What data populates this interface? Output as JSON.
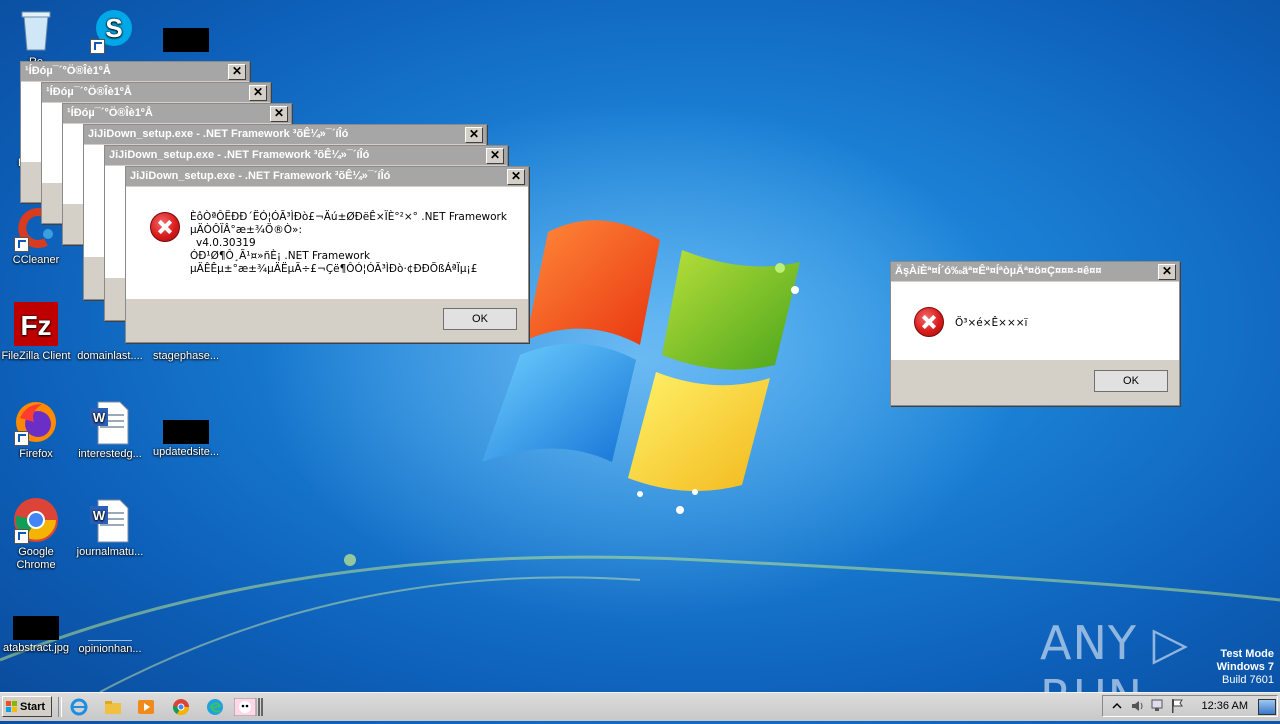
{
  "desktop": {
    "icons": [
      {
        "label": "Re"
      },
      {
        "label": ""
      },
      {
        "label": ""
      },
      {
        "label": "A Re"
      },
      {
        "label": "CCleaner"
      },
      {
        "label": "FileZilla Client"
      },
      {
        "label": "domainlast...."
      },
      {
        "label": "stagephase..."
      },
      {
        "label": "Firefox"
      },
      {
        "label": "interestedg..."
      },
      {
        "label": "updatedsite..."
      },
      {
        "label": "Google Chrome"
      },
      {
        "label": "journalmatu..."
      },
      {
        "label": "atabstract.jpg"
      },
      {
        "label": "opinionhan..."
      }
    ]
  },
  "dialogs": {
    "back1_title": "¹ÍÐóµ¯´°Ö®Îè1ºÅ",
    "back2_title": "¹ÍÐóµ¯´°Ö®Îè1ºÅ",
    "back3_title": "¹ÍÐóµ¯´°Ö®Îè1ºÅ",
    "net1_title": "JiJiDown_setup.exe - .NET Framework ³õÊ¼»¯´íÎó",
    "net2_title": "JiJiDown_setup.exe - .NET Framework ³õÊ¼»¯´íÎó",
    "main": {
      "title": "JiJiDown_setup.exe - .NET Framework ³õÊ¼»¯´íÎó",
      "line1": "ÈôÒªÔËÐÐ´ËÓ¦ÓÃ³ÌÐò£¬Äú±ØÐëÊ×ÏÈ°²×° .NET Framework",
      "line2": "µÄÒÔÏÂ°æ±¾Ö®Ò»:",
      "line3": "v4.0.30319",
      "line4": "ÓÐ¹Ø¶Ô¸Ã¹¤»ñÈ¡ .NET Framework",
      "line5": "µÄÊÊµ±°æ±¾µÄËµÃ÷£¬Çë¶ÔÓ¦ÓÃ³ÌÐò·¢ÐÐÕßÁªÏµ¡£",
      "ok": "OK"
    },
    "right": {
      "title": "ÄşÀíÈª¤Í´ó‰äª¤Êª¤ÍªòµÄª¤ö¤Ç¤¤¤-¤ê¤¤",
      "message": "Ö³×é×Ê×××ï",
      "ok": "OK"
    }
  },
  "taskbar": {
    "start_label": "Start",
    "clock": "12:36 AM"
  },
  "watermark": {
    "line1": "Test Mode",
    "line2": "Windows 7",
    "line3": "Build 7601",
    "brand": "ANY ▷ RUN"
  },
  "colors": {
    "desktop_blue": "#1a7fd4",
    "dialog_gray": "#d4d0c8",
    "error_red": "#d91c1c"
  }
}
